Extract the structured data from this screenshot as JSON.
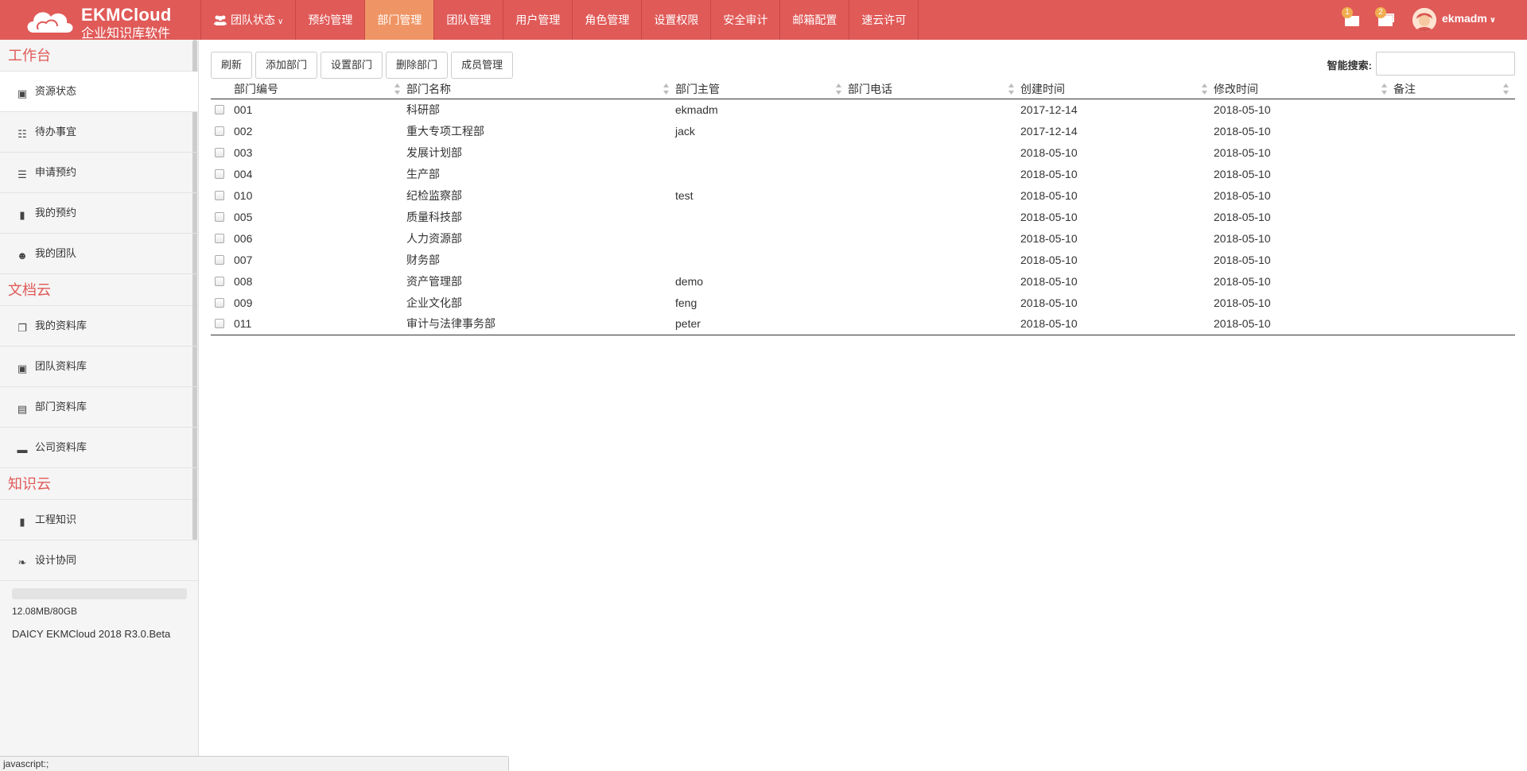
{
  "app": {
    "name": "EKMCloud",
    "subtitle": "企业知识库软件"
  },
  "nav": {
    "items": [
      {
        "label": "团队状态",
        "icon": "users-icon",
        "has_dropdown": true
      },
      {
        "label": "预约管理"
      },
      {
        "label": "部门管理",
        "active": true
      },
      {
        "label": "团队管理"
      },
      {
        "label": "用户管理"
      },
      {
        "label": "角色管理"
      },
      {
        "label": "设置权限"
      },
      {
        "label": "安全审计"
      },
      {
        "label": "邮箱配置"
      },
      {
        "label": "速云许可"
      }
    ]
  },
  "header_right": {
    "messages_badge": "1",
    "tasks_badge": "2",
    "username": "ekmadm"
  },
  "sidebar": {
    "sections": [
      {
        "title": "工作台",
        "items": [
          {
            "label": "资源状态",
            "icon": "dashboard-icon",
            "active": true
          },
          {
            "label": "待办事宜",
            "icon": "clipboard-icon"
          },
          {
            "label": "申请预约",
            "icon": "list-icon"
          },
          {
            "label": "我的预约",
            "icon": "file-icon"
          },
          {
            "label": "我的团队",
            "icon": "users-icon"
          }
        ]
      },
      {
        "title": "文档云",
        "items": [
          {
            "label": "我的资料库",
            "icon": "copy-icon"
          },
          {
            "label": "团队资料库",
            "icon": "contact-icon"
          },
          {
            "label": "部门资料库",
            "icon": "film-icon"
          },
          {
            "label": "公司资料库",
            "icon": "folder-icon"
          }
        ]
      },
      {
        "title": "知识云",
        "items": [
          {
            "label": "工程知识",
            "icon": "book-icon"
          },
          {
            "label": "设计协同",
            "icon": "leaf-icon"
          }
        ]
      }
    ],
    "storage_used_fraction": 0.0002,
    "storage_text": "12.08MB/80GB",
    "version": "DAICY EKMCloud 2018 R3.0.Beta"
  },
  "toolbar": {
    "refresh": "刷新",
    "add": "添加部门",
    "set": "设置部门",
    "delete": "删除部门",
    "members": "成员管理"
  },
  "search": {
    "label": "智能搜索:",
    "value": ""
  },
  "table": {
    "columns": [
      "部门编号",
      "部门名称",
      "部门主管",
      "部门电话",
      "创建时间",
      "修改时间",
      "备注"
    ],
    "rows": [
      [
        "001",
        "科研部",
        "ekmadm",
        "",
        "2017-12-14",
        "2018-05-10",
        ""
      ],
      [
        "002",
        "重大专项工程部",
        "jack",
        "",
        "2017-12-14",
        "2018-05-10",
        ""
      ],
      [
        "003",
        "发展计划部",
        "",
        "",
        "2018-05-10",
        "2018-05-10",
        ""
      ],
      [
        "004",
        "生产部",
        "",
        "",
        "2018-05-10",
        "2018-05-10",
        ""
      ],
      [
        "010",
        "纪检监察部",
        "test",
        "",
        "2018-05-10",
        "2018-05-10",
        ""
      ],
      [
        "005",
        "质量科技部",
        "",
        "",
        "2018-05-10",
        "2018-05-10",
        ""
      ],
      [
        "006",
        "人力资源部",
        "",
        "",
        "2018-05-10",
        "2018-05-10",
        ""
      ],
      [
        "007",
        "财务部",
        "",
        "",
        "2018-05-10",
        "2018-05-10",
        ""
      ],
      [
        "008",
        "资产管理部",
        "demo",
        "",
        "2018-05-10",
        "2018-05-10",
        ""
      ],
      [
        "009",
        "企业文化部",
        "feng",
        "",
        "2018-05-10",
        "2018-05-10",
        ""
      ],
      [
        "011",
        "审计与法律事务部",
        "peter",
        "",
        "2018-05-10",
        "2018-05-10",
        ""
      ]
    ]
  },
  "statusbar": {
    "text": "javascript:;"
  },
  "colors": {
    "brand": "#e05a58",
    "nav_active": "#ef9565",
    "badge": "#f0ad4e"
  }
}
